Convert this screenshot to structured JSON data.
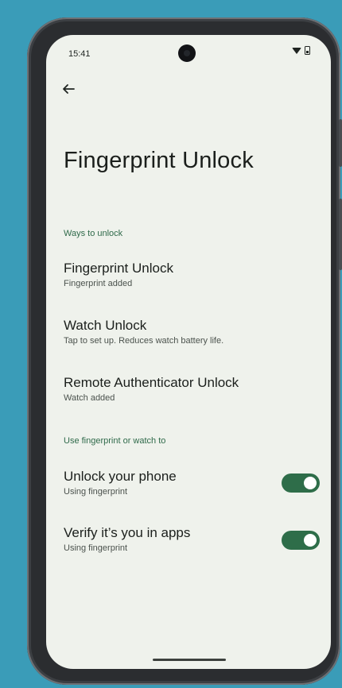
{
  "status_bar": {
    "time": "15:41"
  },
  "page": {
    "title": "Fingerprint Unlock"
  },
  "sections": [
    {
      "header": "Ways to unlock"
    },
    {
      "header": "Use fingerprint or watch to"
    }
  ],
  "unlock_methods": [
    {
      "title": "Fingerprint Unlock",
      "subtitle": "Fingerprint added"
    },
    {
      "title": "Watch Unlock",
      "subtitle": "Tap to set up. Reduces watch battery life."
    },
    {
      "title": "Remote Authenticator Unlock",
      "subtitle": "Watch added"
    }
  ],
  "uses": [
    {
      "title": "Unlock your phone",
      "subtitle": "Using fingerprint",
      "enabled": true
    },
    {
      "title": "Verify it’s you in apps",
      "subtitle": "Using fingerprint",
      "enabled": true
    }
  ],
  "colors": {
    "accent": "#2e6d49",
    "background": "#eff2ec",
    "page_bg": "#3a9cb8"
  },
  "icons": {
    "back": "arrow-left-icon",
    "wifi": "wifi-icon",
    "battery": "battery-icon"
  }
}
